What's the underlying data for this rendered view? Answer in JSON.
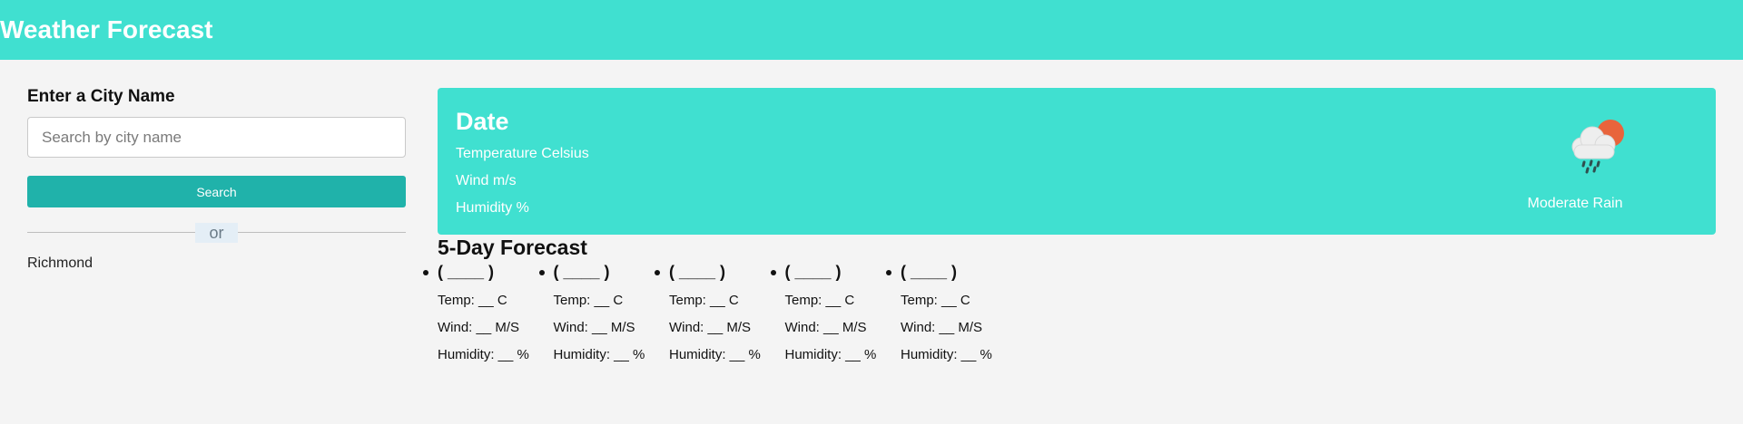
{
  "header": {
    "title": "Weather Forecast"
  },
  "sidebar": {
    "label": "Enter a City Name",
    "search_placeholder": "Search by city name",
    "search_button": "Search",
    "divider_text": "or",
    "history": [
      "Richmond"
    ]
  },
  "current": {
    "date": "Date",
    "temperature": "Temperature Celsius",
    "wind": "Wind m/s",
    "humidity": "Humidity %",
    "description": "Moderate Rain",
    "icon": "cloud-sun-rain-icon"
  },
  "forecast": {
    "title": "5-Day Forecast",
    "days": [
      {
        "date": "( ____ )",
        "temp": "Temp: __ C",
        "wind": "Wind: __ M/S",
        "humidity": "Humidity: __ %"
      },
      {
        "date": "( ____ )",
        "temp": "Temp: __ C",
        "wind": "Wind: __ M/S",
        "humidity": "Humidity: __ %"
      },
      {
        "date": "( ____ )",
        "temp": "Temp: __ C",
        "wind": "Wind: __ M/S",
        "humidity": "Humidity: __ %"
      },
      {
        "date": "( ____ )",
        "temp": "Temp: __ C",
        "wind": "Wind: __ M/S",
        "humidity": "Humidity: __ %"
      },
      {
        "date": "( ____ )",
        "temp": "Temp: __ C",
        "wind": "Wind: __ M/S",
        "humidity": "Humidity: __ %"
      }
    ]
  },
  "colors": {
    "accent": "#40e0d0",
    "button": "#20b2aa",
    "background": "#f4f4f4",
    "sun": "#e8643c"
  }
}
